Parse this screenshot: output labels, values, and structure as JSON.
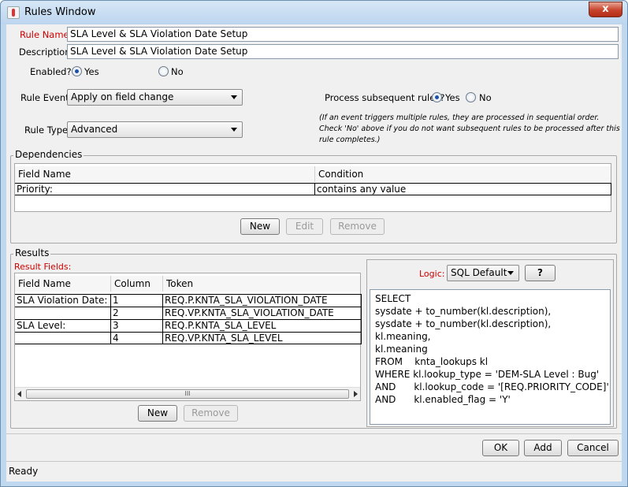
{
  "window": {
    "title": "Rules Window",
    "close_label": "x"
  },
  "rule_name": {
    "label": "Rule Name:",
    "value": "SLA Level & SLA Violation Date Setup"
  },
  "description": {
    "label": "Description:",
    "value": "SLA Level & SLA Violation Date Setup"
  },
  "enabled": {
    "label": "Enabled?",
    "yes": "Yes",
    "no": "No"
  },
  "rule_event": {
    "label": "Rule Event:",
    "value": "Apply on field change"
  },
  "rule_type": {
    "label": "Rule Type:",
    "value": "Advanced"
  },
  "process_subsequent": {
    "label": "Process subsequent rules?",
    "yes": "Yes",
    "no": "No",
    "note_line1": "(If an event triggers multiple rules, they are processed in sequential order.",
    "note_line2": "Check 'No' above if you do not want subsequent rules to be processed after this",
    "note_line3": "rule completes.)"
  },
  "dependencies": {
    "title": "Dependencies",
    "columns": [
      "Field Name",
      "Condition"
    ],
    "rows": [
      {
        "field": "Priority:",
        "condition": "contains any value"
      }
    ],
    "buttons": {
      "new": "New",
      "edit": "Edit",
      "remove": "Remove"
    }
  },
  "results": {
    "title": "Results",
    "fields_label": "Result Fields:",
    "columns": [
      "Field Name",
      "Column",
      "Token"
    ],
    "rows": [
      {
        "field": "SLA Violation Date:",
        "column": "1",
        "token": "REQ.P.KNTA_SLA_VIOLATION_DATE"
      },
      {
        "field": "",
        "column": "2",
        "token": "REQ.VP.KNTA_SLA_VIOLATION_DATE"
      },
      {
        "field": "SLA Level:",
        "column": "3",
        "token": "REQ.P.KNTA_SLA_LEVEL"
      },
      {
        "field": "",
        "column": "4",
        "token": "REQ.VP.KNTA_SLA_LEVEL"
      }
    ],
    "buttons": {
      "new": "New",
      "remove": "Remove"
    },
    "scroll_grip": "III"
  },
  "logic": {
    "label": "Logic:",
    "value": "SQL Default",
    "help": "?",
    "sql": "SELECT\nsysdate + to_number(kl.description),\nsysdate + to_number(kl.description),\nkl.meaning,\nkl.meaning\nFROM    knta_lookups kl\nWHERE kl.lookup_type = 'DEM-SLA Level : Bug'\nAND      kl.lookup_code = '[REQ.PRIORITY_CODE]'\nAND      kl.enabled_flag = 'Y'"
  },
  "footer": {
    "ok": "OK",
    "add": "Add",
    "cancel": "Cancel"
  },
  "status": {
    "text": "Ready"
  }
}
